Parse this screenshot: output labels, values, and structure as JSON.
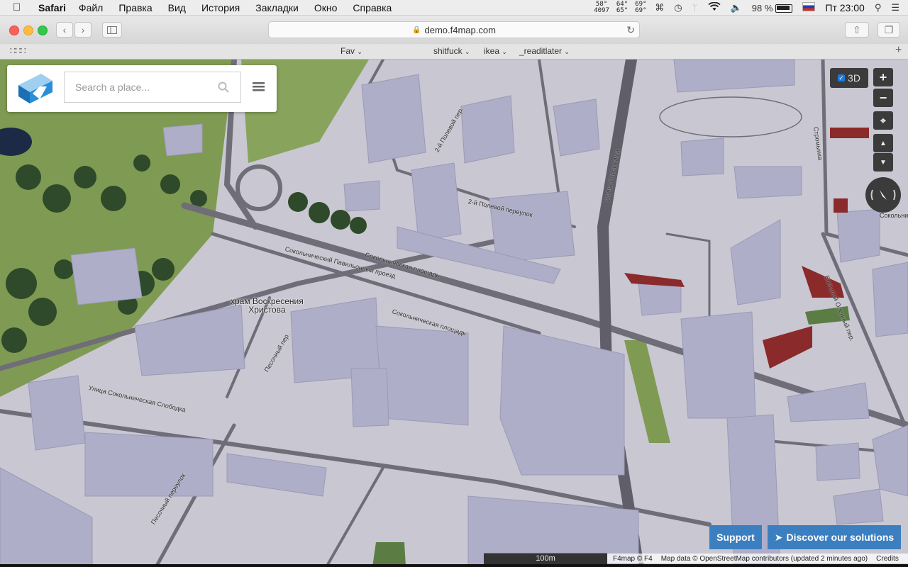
{
  "menubar": {
    "app_name": "Safari",
    "items": [
      "Файл",
      "Правка",
      "Вид",
      "История",
      "Закладки",
      "Окно",
      "Справка"
    ],
    "temps": [
      [
        "58°",
        "4097"
      ],
      [
        "64°",
        "65°"
      ],
      [
        "69°",
        "69°"
      ]
    ],
    "battery": "98 %",
    "clock": "Пт 23:00"
  },
  "toolbar": {
    "url": "demo.f4map.com"
  },
  "bookmarks": {
    "items": [
      "Fav",
      "shitfuck",
      "ikea",
      "_readitlater"
    ]
  },
  "panel": {
    "search_placeholder": "Search a place..."
  },
  "map": {
    "poi_label_line1": "храм Воскресения",
    "poi_label_line2": "Христова",
    "streets": [
      "Сокольнический Павильонный проезд",
      "Сокольническая площадь",
      "Сокольническая площадь",
      "Улица Сокольническая Слободка",
      "Песочный переулок",
      "Песочный пер.",
      "2-й Полевой переулок",
      "2-й Полевой пер.",
      "улица Стромынка",
      "Сокольническая площадь",
      "Большой Оленный пер.",
      "Стромынка"
    ]
  },
  "controls": {
    "toggle_3d_label": "3D",
    "zoom_in": "+",
    "zoom_out": "−"
  },
  "footer": {
    "support_label": "Support",
    "discover_label": "Discover our solutions",
    "scale_label": "100m",
    "f4map_credit": "F4map © F4",
    "map_data": "Map data © OpenStreetMap contributors (updated 2 minutes ago)",
    "credits": "Credits"
  },
  "colors": {
    "ground": "#c9c7d2",
    "building": "#aeaec9",
    "road": "#6e6d78",
    "park": "#7f9a52",
    "button_blue": "#3c7fc0",
    "control_dark": "#3b3b3b"
  }
}
